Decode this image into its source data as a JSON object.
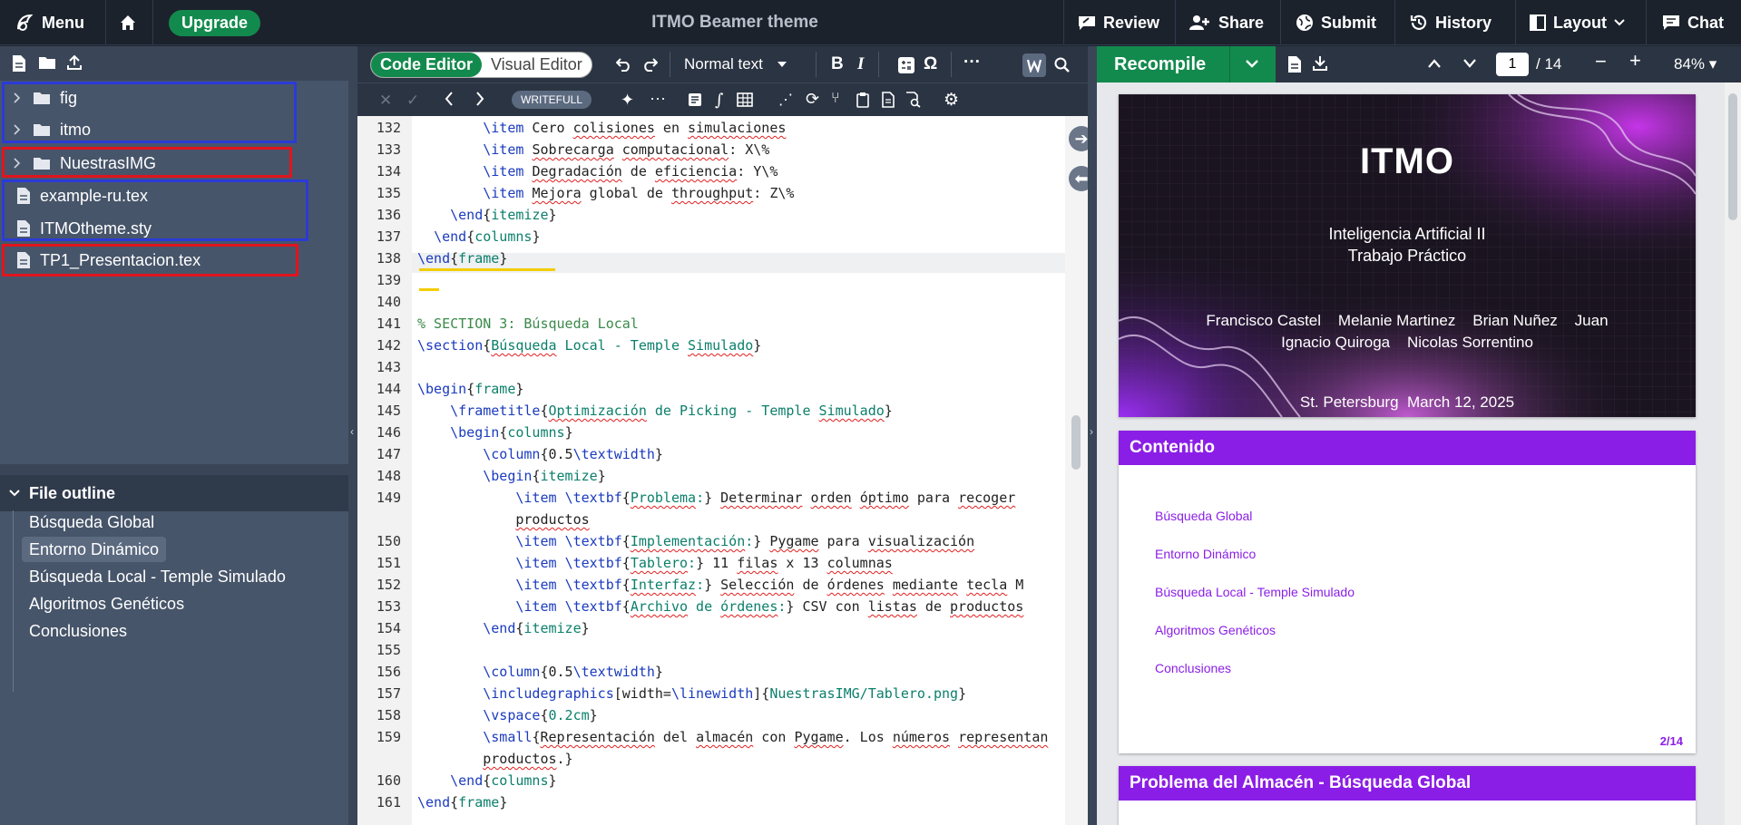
{
  "topbar": {
    "menu_label": "Menu",
    "upgrade_label": "Upgrade",
    "title": "ITMO Beamer theme",
    "review_label": "Review",
    "share_label": "Share",
    "submit_label": "Submit",
    "history_label": "History",
    "layout_label": "Layout",
    "chat_label": "Chat"
  },
  "file_tree": {
    "items": [
      {
        "label": "fig",
        "type": "folder"
      },
      {
        "label": "itmo",
        "type": "folder"
      },
      {
        "label": "NuestrasIMG",
        "type": "folder"
      },
      {
        "label": "example-ru.tex",
        "type": "file"
      },
      {
        "label": "ITMOtheme.sty",
        "type": "file"
      },
      {
        "label": "TP1_Presentacion.tex",
        "type": "file"
      }
    ],
    "highlight_colors": {
      "blue": "#2b3bd6",
      "red": "#e0141e"
    }
  },
  "outline": {
    "header": "File outline",
    "items": [
      "Búsqueda Global",
      "Entorno Dinámico",
      "Búsqueda Local - Temple Simulado",
      "Algoritmos Genéticos",
      "Conclusiones"
    ],
    "selected_index": 1
  },
  "editor": {
    "code_editor_label": "Code Editor",
    "visual_editor_label": "Visual Editor",
    "style_select": "Normal text",
    "writefull_label": "WRITEFULL",
    "line_numbers": [
      "132",
      "133",
      "134",
      "135",
      "136",
      "137",
      "138",
      "139",
      "140",
      "141",
      "142",
      "143",
      "144",
      "145",
      "146",
      "147",
      "148",
      "149",
      "",
      "150",
      "151",
      "152",
      "153",
      "154",
      "155",
      "156",
      "157",
      "158",
      "159",
      "",
      "160",
      "161"
    ],
    "lines": [
      "        \\item Cero colisiones en simulaciones",
      "        \\item Sobrecarga computacional: X\\%",
      "        \\item Degradación de eficiencia: Y\\%",
      "        \\item Mejora global de throughput: Z\\%",
      "    \\end{itemize}",
      "  \\end{columns}",
      "\\end{frame}",
      "",
      "",
      "% SECTION 3: Búsqueda Local",
      "\\section{Búsqueda Local - Temple Simulado}",
      "",
      "\\begin{frame}",
      "    \\frametitle{Optimización de Picking - Temple Simulado}",
      "    \\begin{columns}",
      "        \\column{0.5\\textwidth}",
      "        \\begin{itemize}",
      "            \\item \\textbf{Problema:} Determinar orden óptimo para recoger",
      "            productos",
      "            \\item \\textbf{Implementación:} Pygame para visualización",
      "            \\item \\textbf{Tablero:} 11 filas x 13 columnas",
      "            \\item \\textbf{Interfaz:} Selección de órdenes mediante tecla M",
      "            \\item \\textbf{Archivo de órdenes:} CSV con listas de productos",
      "        \\end{itemize}",
      "",
      "        \\column{0.5\\textwidth}",
      "        \\includegraphics[width=\\linewidth]{NuestrasIMG/Tablero.png}",
      "        \\vspace{0.2cm}",
      "        \\small{Representación del almacén con Pygame. Los números representan",
      "        productos.}",
      "    \\end{columns}",
      "\\end{frame}"
    ]
  },
  "preview": {
    "recompile_label": "Recompile",
    "page_current": "1",
    "page_total": "/ 14",
    "zoom": "84%",
    "slide1": {
      "logo": "ITMO",
      "subtitle_line1": "Inteligencia Artificial II",
      "subtitle_line2": "Trabajo Práctico",
      "authors_line1": "Francisco Castel    Melanie Martinez    Brian Nuñez    Juan",
      "authors_line2": "Ignacio Quiroga    Nicolas Sorrentino",
      "place_date": "St. Petersburg  March 12, 2025"
    },
    "slide2": {
      "title": "Contenido",
      "toc": [
        "Búsqueda Global",
        "Entorno Dinámico",
        "Búsqueda Local - Temple Simulado",
        "Algoritmos Genéticos",
        "Conclusiones"
      ],
      "page_num": "2/14"
    },
    "slide3": {
      "title": "Problema del Almacén - Búsqueda Global"
    }
  },
  "colors": {
    "accent_green": "#138a4d",
    "slide_purple": "#8b1ee6"
  }
}
